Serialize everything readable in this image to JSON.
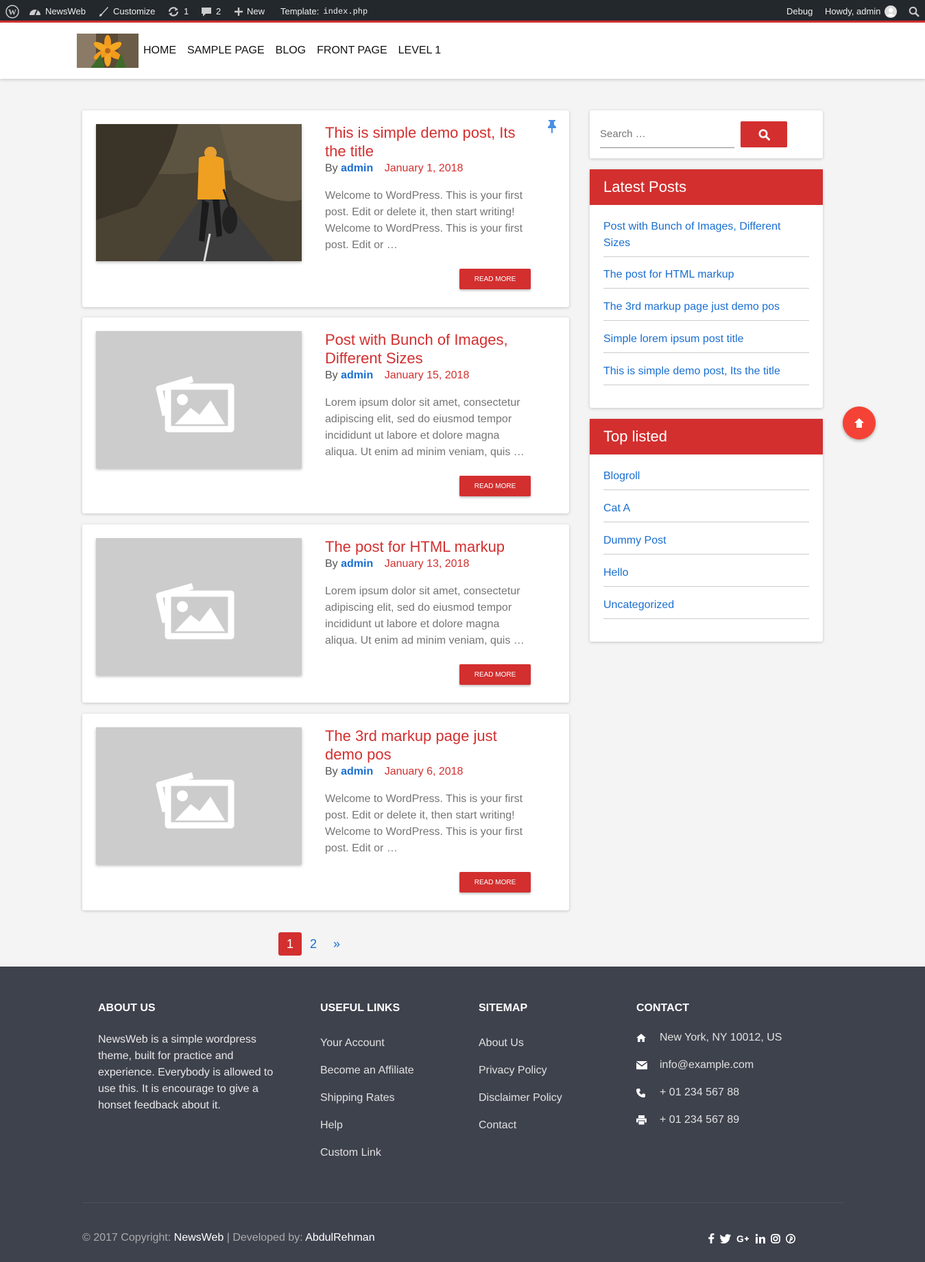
{
  "admin_bar": {
    "site_name": "NewsWeb",
    "customize": "Customize",
    "updates": "1",
    "comments": "2",
    "new": "New",
    "template_label": "Template:",
    "template_file": "index.php",
    "debug": "Debug",
    "howdy": "Howdy, admin"
  },
  "nav": {
    "items": [
      "HOME",
      "SAMPLE PAGE",
      "BLOG",
      "FRONT PAGE",
      "LEVEL 1"
    ]
  },
  "posts": [
    {
      "title": "This is simple demo post, Its the title",
      "by": "By",
      "author": "admin",
      "date": "January 1, 2018",
      "excerpt": "Welcome to WordPress. This is your first post. Edit or delete it, then start writing! Welcome to WordPress. This is your first post. Edit or …",
      "read_more": "READ MORE",
      "sticky": true
    },
    {
      "title": "Post with Bunch of Images, Different Sizes",
      "by": "By",
      "author": "admin",
      "date": "January 15, 2018",
      "excerpt": "Lorem ipsum dolor sit amet, consectetur adipiscing elit, sed do eiusmod tempor incididunt ut labore et dolore magna aliqua. Ut enim ad minim veniam, quis …",
      "read_more": "READ MORE"
    },
    {
      "title": "The post for HTML markup",
      "by": "By",
      "author": "admin",
      "date": "January 13, 2018",
      "excerpt": "Lorem ipsum dolor sit amet, consectetur adipiscing elit, sed do eiusmod tempor incididunt ut labore et dolore magna aliqua. Ut enim ad minim veniam, quis …",
      "read_more": "READ MORE"
    },
    {
      "title": "The 3rd markup page just demo pos",
      "by": "By",
      "author": "admin",
      "date": "January 6, 2018",
      "excerpt": "Welcome to WordPress. This is your first post. Edit or delete it, then start writing! Welcome to WordPress. This is your first post. Edit or …",
      "read_more": "READ MORE"
    }
  ],
  "pagination": {
    "current": "1",
    "next_page": "2",
    "next_arrow": "»"
  },
  "search": {
    "placeholder": "Search …"
  },
  "latest_posts": {
    "heading": "Latest Posts",
    "items": [
      "Post with Bunch of Images, Different Sizes",
      "The post for HTML markup",
      "The 3rd markup page just demo pos",
      "Simple lorem ipsum post title",
      "This is simple demo post, Its the title"
    ]
  },
  "top_listed": {
    "heading": "Top listed",
    "items": [
      "Blogroll",
      "Cat A",
      "Dummy Post",
      "Hello",
      "Uncategorized"
    ]
  },
  "footer": {
    "about": {
      "heading": "ABOUT US",
      "text": "NewsWeb is a simple wordpress theme, built for practice and experience. Everybody is allowed to use this. It is encourage to give a honset feedback about it."
    },
    "useful_links": {
      "heading": "USEFUL LINKS",
      "items": [
        "Your Account",
        "Become an Affiliate",
        "Shipping Rates",
        "Help",
        "Custom Link"
      ]
    },
    "sitemap": {
      "heading": "SITEMAP",
      "items": [
        "About Us",
        "Privacy Policy",
        "Disclaimer Policy",
        "Contact"
      ]
    },
    "contact": {
      "heading": "CONTACT",
      "address": "New York, NY 10012, US",
      "email": "info@example.com",
      "phone": "+ 01 234 567 88",
      "fax": "+ 01 234 567 89"
    },
    "copyright": {
      "prefix": "© 2017 Copyright:",
      "site": "NewsWeb",
      "separator": "| Developed by:",
      "developer": "AbdulRehman"
    },
    "social_icons": [
      "facebook-icon",
      "twitter-icon",
      "google-plus-icon",
      "linkedin-icon",
      "instagram-icon",
      "pinterest-icon"
    ]
  },
  "colors": {
    "accent": "#d32f2f",
    "link": "#1a6fd1",
    "footer_bg": "#3e424d",
    "admin_bar_bg": "#23282d"
  }
}
